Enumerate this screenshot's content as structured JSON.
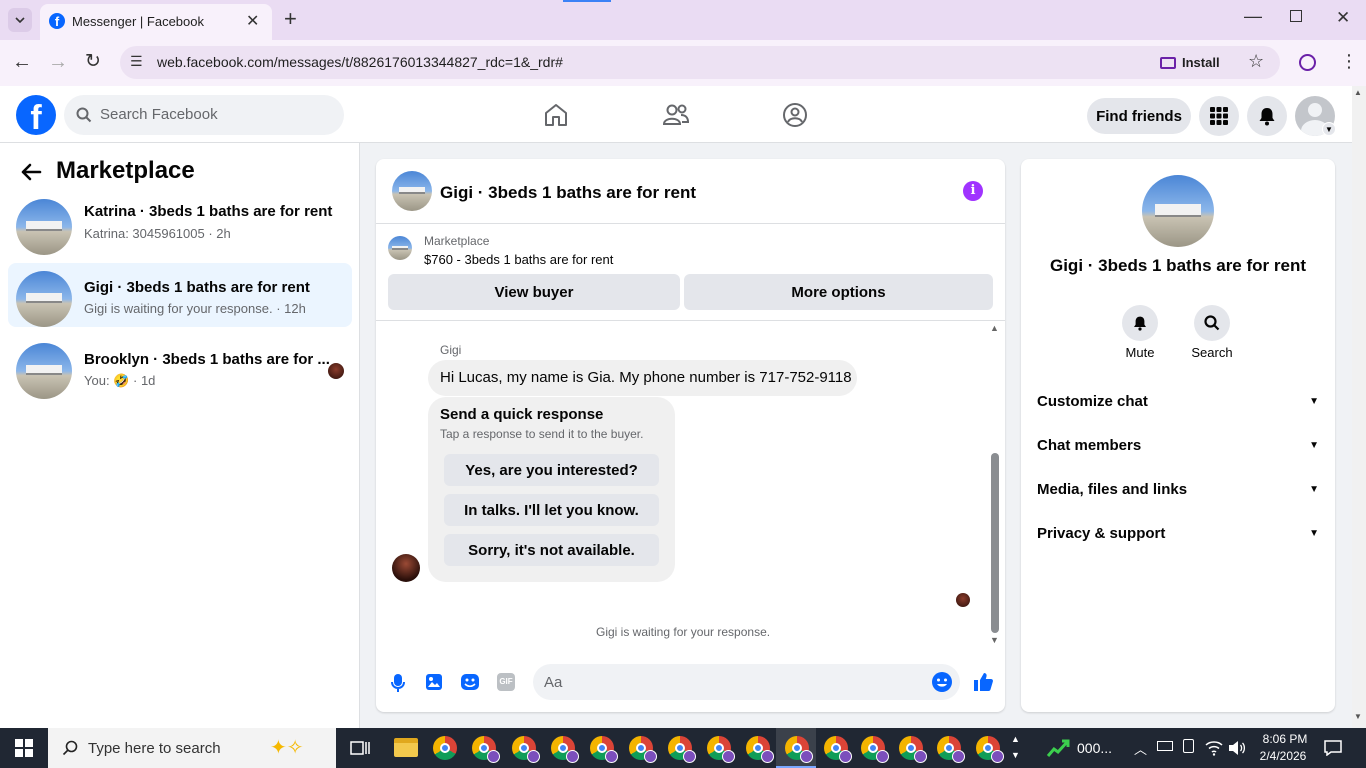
{
  "browser": {
    "tab_title": "Messenger | Facebook",
    "url": "web.facebook.com/messages/t/8826176013344827_rdc=1&_rdr#",
    "install_label": "Install"
  },
  "header": {
    "search_placeholder": "Search Facebook",
    "find_friends_label": "Find friends"
  },
  "left": {
    "title": "Marketplace",
    "conversations": [
      {
        "name": "Katrina · 3beds 1 baths are for rent",
        "subtitle": "Katrina: 3045961005 · 2h"
      },
      {
        "name": "Gigi · 3beds 1 baths are for rent",
        "subtitle": "Gigi is waiting for your response. · 12h"
      },
      {
        "name": "Brooklyn · 3beds 1 baths are for ...",
        "subtitle_prefix": "You:",
        "subtitle_emoji": "🤣",
        "subtitle_time": "· 1d"
      }
    ]
  },
  "chat": {
    "title": "Gigi · 3beds 1 baths are for rent",
    "listing_label": "Marketplace",
    "listing_title": "$760 - 3beds 1 baths are for rent",
    "view_buyer_label": "View buyer",
    "more_options_label": "More options",
    "sender_name": "Gigi",
    "message_text": "Hi Lucas, my name is Gia. My phone number is 717-752-9118",
    "quick_title": "Send a quick response",
    "quick_subtitle": "Tap a response to send it to the buyer.",
    "quick_responses": [
      "Yes, are you interested?",
      "In talks. I'll let you know.",
      "Sorry, it's not available."
    ],
    "waiting_text": "Gigi is waiting for your response.",
    "composer_placeholder": "Aa"
  },
  "info": {
    "name": "Gigi · 3beds 1 baths are for rent",
    "mute_label": "Mute",
    "search_label": "Search",
    "sections": [
      "Customize chat",
      "Chat members",
      "Media, files and links",
      "Privacy & support"
    ]
  },
  "taskbar": {
    "search_placeholder": "Type here to search",
    "stock_label": "000...",
    "time": "8:06 PM",
    "date": "2/4/2026"
  },
  "colors": {
    "brand": "#0866ff",
    "accent_purple": "#a033ff"
  }
}
